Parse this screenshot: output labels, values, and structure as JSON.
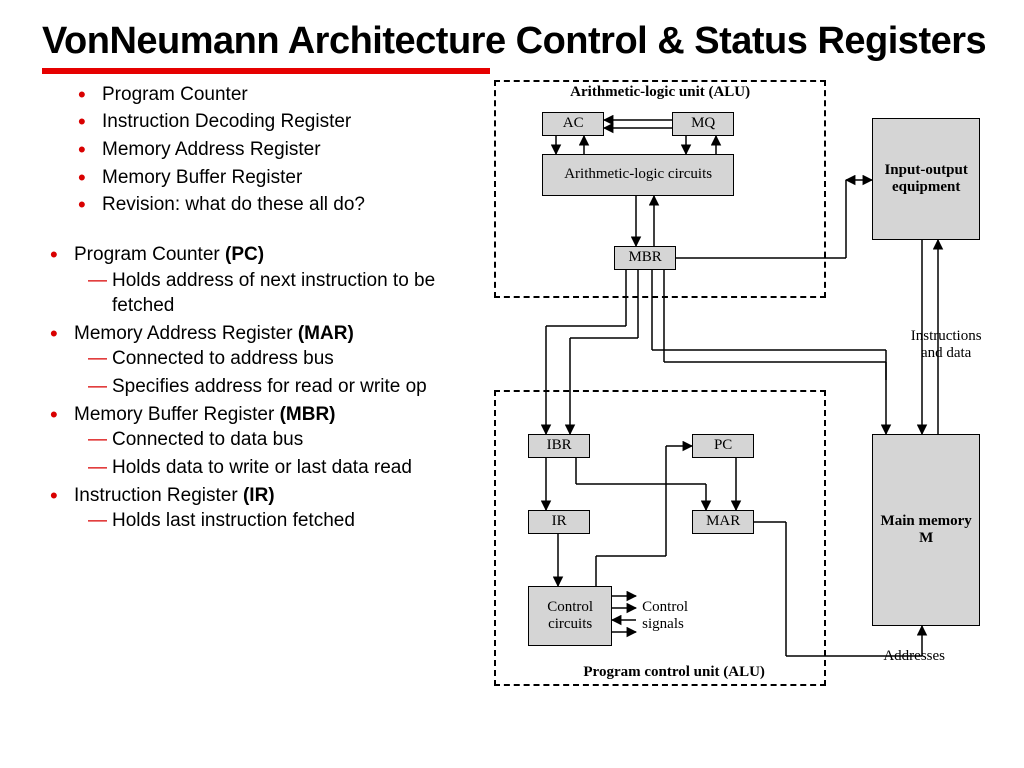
{
  "title": "VonNeumann Architecture Control & Status Registers",
  "bullets_top": [
    "Program Counter",
    "Instruction Decoding Register",
    "Memory Address Register",
    "Memory Buffer Register",
    "Revision: what do these all do?"
  ],
  "detail": [
    {
      "label": "Program Counter",
      "abbr": "(PC)",
      "subs": [
        "Holds address of next instruction to be fetched"
      ]
    },
    {
      "label": "Memory Address Register",
      "abbr": "(MAR)",
      "subs": [
        "Connected to address bus",
        "Specifies address for read or write op"
      ]
    },
    {
      "label": "Memory Buffer Register",
      "abbr": "(MBR)",
      "subs": [
        "Connected to data bus",
        "Holds data to write or last data read"
      ]
    },
    {
      "label": "Instruction Register",
      "abbr": "(IR)",
      "subs": [
        "Holds last instruction fetched"
      ]
    }
  ],
  "diagram": {
    "alu_title": "Arithmetic-logic unit (ALU)",
    "pcu_title": "Program control unit (ALU)",
    "boxes": {
      "ac": "AC",
      "mq": "MQ",
      "alc": "Arithmetic-logic circuits",
      "mbr": "MBR",
      "ibr": "IBR",
      "pc": "PC",
      "ir": "IR",
      "mar": "MAR",
      "ctrl": "Control circuits",
      "io": "Input-output equipment",
      "mem": "Main memory M"
    },
    "labels": {
      "ctrl_signals": "Control signals",
      "instr_data": "Instructions and data",
      "addresses": "Addresses"
    }
  }
}
